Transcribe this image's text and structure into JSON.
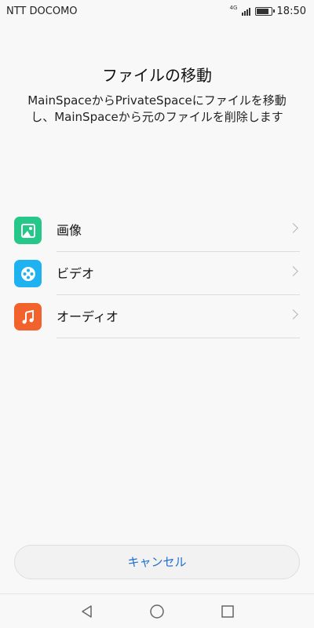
{
  "status_bar": {
    "carrier": "NTT DOCOMO",
    "network": "4G",
    "time": "18:50",
    "battery_level": 0.75
  },
  "header": {
    "title": "ファイルの移動",
    "description": "MainSpaceからPrivateSpaceにファイルを移動し、MainSpaceから元のファイルを削除します"
  },
  "file_types": [
    {
      "label": "画像",
      "icon": "image-icon",
      "color": "#26c88a"
    },
    {
      "label": "ビデオ",
      "icon": "video-icon",
      "color": "#1eb3f0"
    },
    {
      "label": "オーディオ",
      "icon": "music-icon",
      "color": "#f2622c"
    }
  ],
  "actions": {
    "cancel_label": "キャンセル"
  },
  "nav": {
    "back": "back-icon",
    "home": "home-icon",
    "recents": "recents-icon"
  }
}
